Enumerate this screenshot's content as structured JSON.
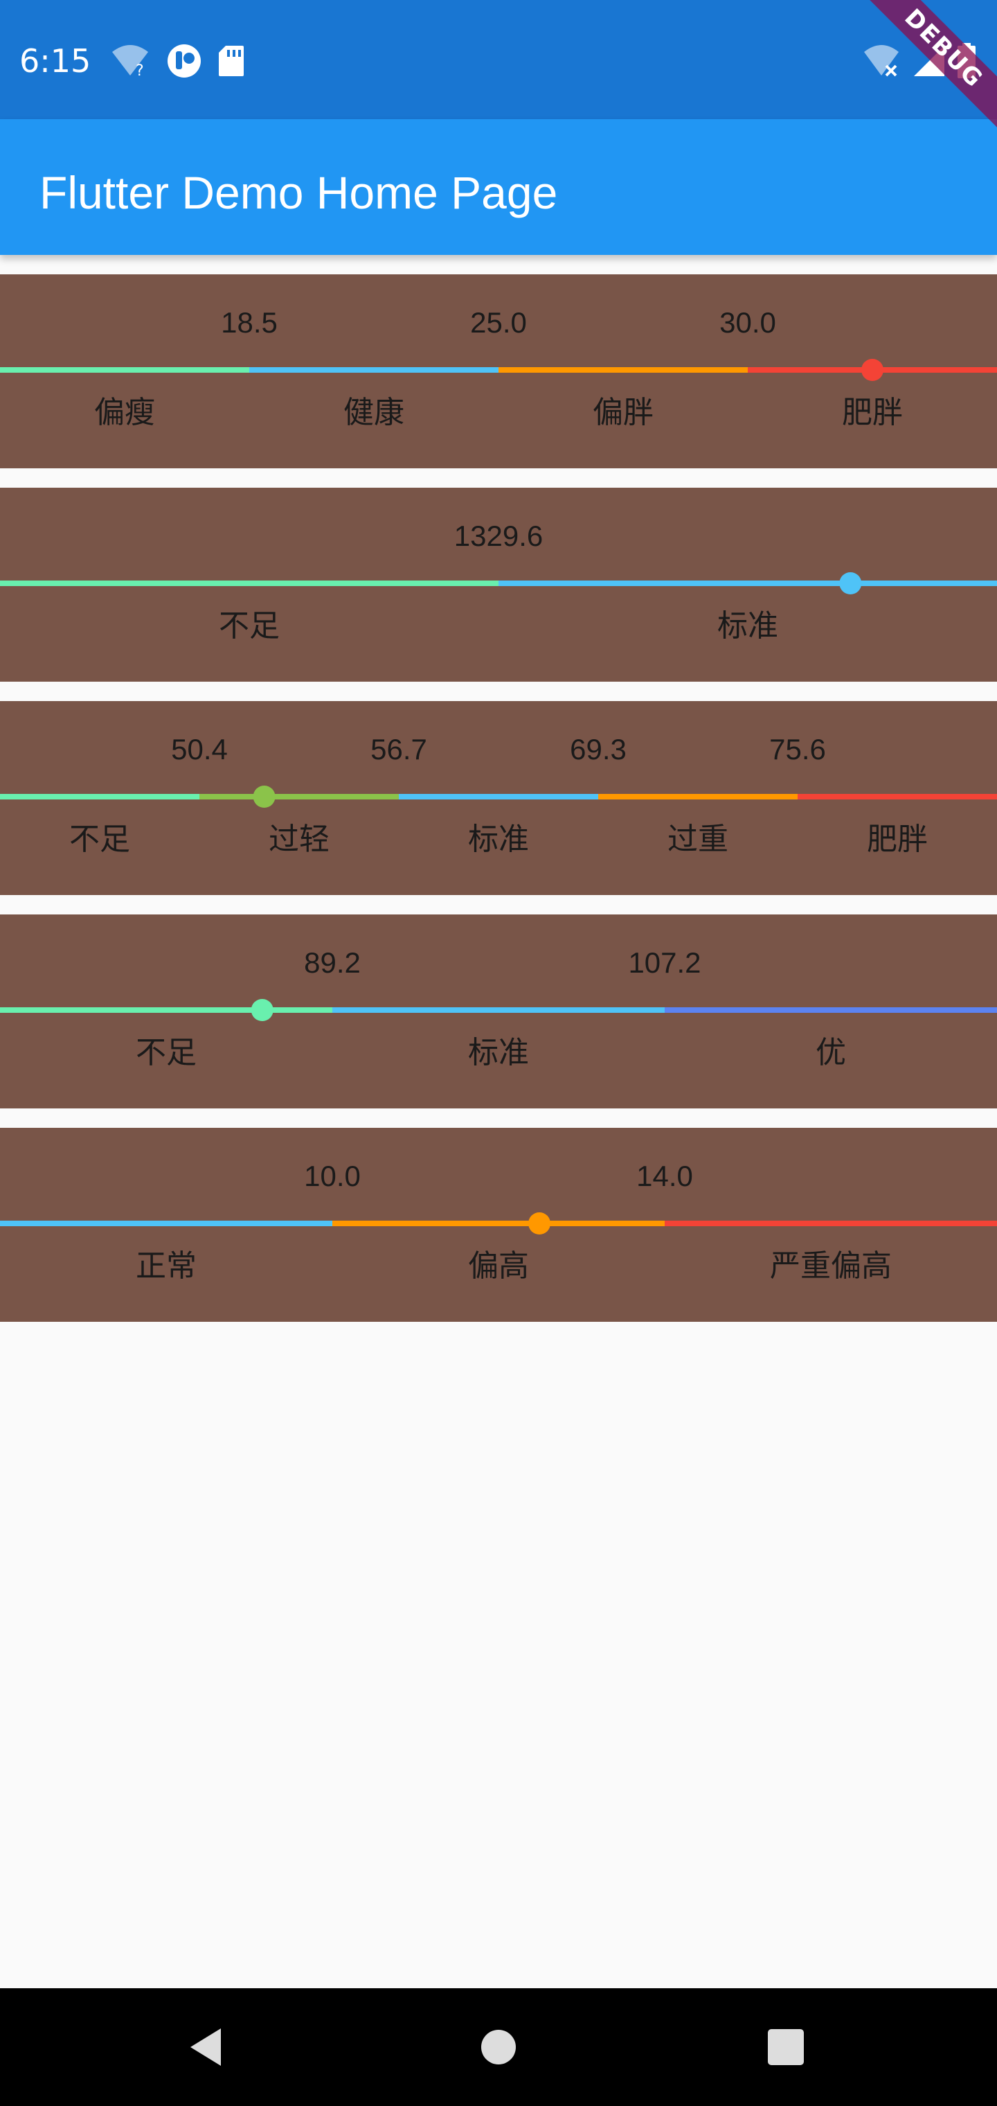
{
  "status_bar": {
    "time": "6:15",
    "left_icons": [
      "wifi-question-icon",
      "app-badge-icon",
      "sd-card-icon"
    ],
    "right_icons": [
      "wifi-off-icon",
      "signal-icon",
      "battery-icon"
    ]
  },
  "debug_banner": "DEBUG",
  "app_bar": {
    "title": "Flutter Demo Home Page"
  },
  "colors": {
    "card_background": "#795548",
    "app_bar": "#2196F3",
    "status_bar": "#1976D2"
  },
  "cards": [
    {
      "thresholds": [
        "18.5",
        "25.0",
        "30.0"
      ],
      "labels": [
        "偏瘦",
        "健康",
        "偏胖",
        "肥胖"
      ],
      "colors": [
        "#69F0AE",
        "#4FC3F7",
        "#FF9800",
        "#F44336"
      ],
      "value_fraction": 0.875
    },
    {
      "thresholds": [
        "1329.6"
      ],
      "labels": [
        "不足",
        "标准"
      ],
      "colors": [
        "#69F0AE",
        "#4FC3F7"
      ],
      "value_fraction": 0.853
    },
    {
      "thresholds": [
        "50.4",
        "56.7",
        "69.3",
        "75.6"
      ],
      "labels": [
        "不足",
        "过轻",
        "标准",
        "过重",
        "肥胖"
      ],
      "colors": [
        "#69F0AE",
        "#8BC34A",
        "#4FC3F7",
        "#FF9800",
        "#F44336"
      ],
      "value_fraction": 0.265
    },
    {
      "thresholds": [
        "89.2",
        "107.2"
      ],
      "labels": [
        "不足",
        "标准",
        "优"
      ],
      "colors": [
        "#69F0AE",
        "#4FC3F7",
        "#5C83F2"
      ],
      "value_fraction": 0.263
    },
    {
      "thresholds": [
        "10.0",
        "14.0"
      ],
      "labels": [
        "正常",
        "偏高",
        "严重偏高"
      ],
      "colors": [
        "#4FC3F7",
        "#FF9800",
        "#F44336"
      ],
      "value_fraction": 0.541
    }
  ],
  "nav_bar": {
    "buttons": [
      "back-icon",
      "home-icon",
      "recents-icon"
    ]
  }
}
